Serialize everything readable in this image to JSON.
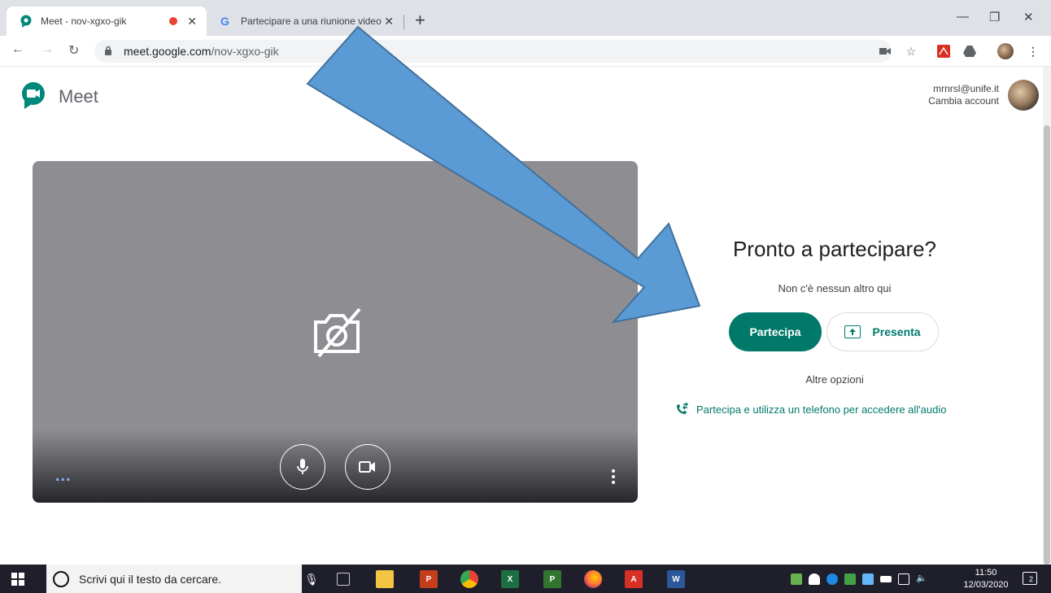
{
  "browser": {
    "tabs": [
      {
        "title": "Meet - nov-xgxo-gik",
        "favicon": "meet-icon",
        "recording": true,
        "active": true
      },
      {
        "title": "Partecipare a una riunione video",
        "favicon": "google-g-icon",
        "active": false
      }
    ],
    "url_host": "meet.google.com",
    "url_path": "/nov-xgxo-gik"
  },
  "meet": {
    "app_name": "Meet",
    "account_email": "mrnrsl@unife.it",
    "switch_account": "Cambia account",
    "preview_more": "...",
    "ready_title": "Pronto a partecipare?",
    "nobody_here": "Non c'è nessun altro qui",
    "join_label": "Partecipa",
    "present_label": "Presenta",
    "other_options": "Altre opzioni",
    "phone_option": "Partecipa e utilizza un telefono per accedere all'audio"
  },
  "taskbar": {
    "search_placeholder": "Scrivi qui il testo da cercare.",
    "time": "11:50",
    "date": "12/03/2020",
    "notification_count": "2"
  },
  "colors": {
    "accent": "#00796b",
    "arrow_fill": "#5b9bd5",
    "arrow_stroke": "#41719c",
    "preview_bg": "#8e8d92"
  }
}
